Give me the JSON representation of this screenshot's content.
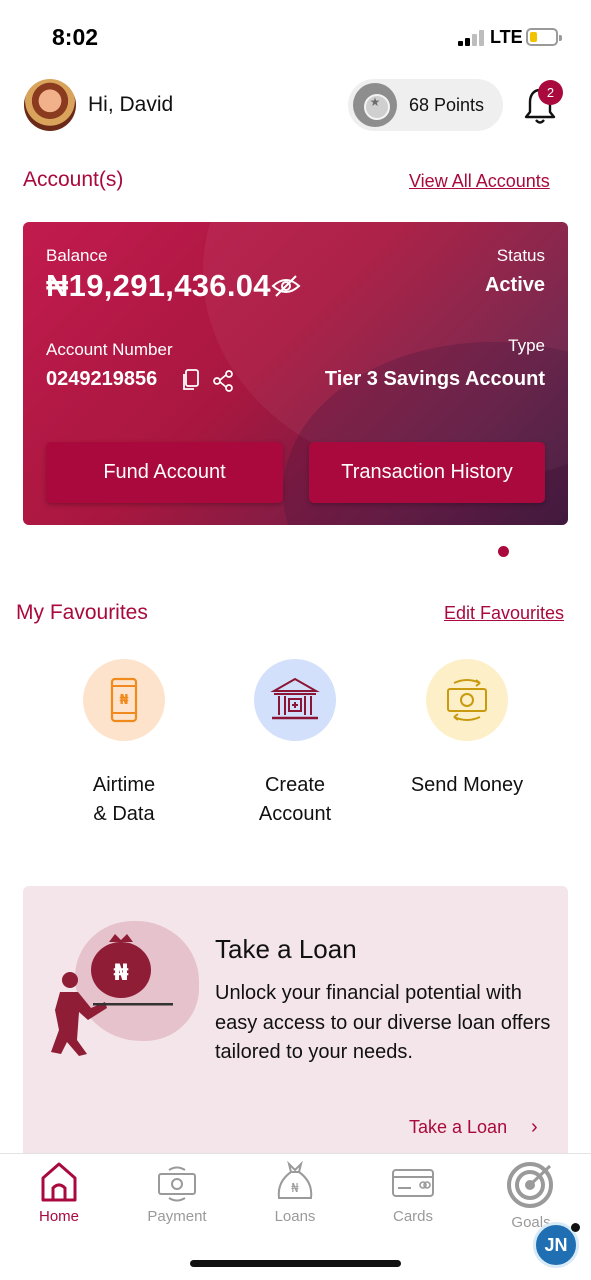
{
  "status_bar": {
    "time": "8:02",
    "network": "LTE"
  },
  "header": {
    "greeting": "Hi, David",
    "points": "68 Points",
    "notification_count": "2"
  },
  "accounts": {
    "title": "Account(s)",
    "view_all": "View All Accounts",
    "card": {
      "balance_label": "Balance",
      "balance": "₦19,291,436.04",
      "status_label": "Status",
      "status": "Active",
      "account_number_label": "Account Number",
      "account_number": "0249219856",
      "type_label": "Type",
      "type": "Tier 3 Savings Account",
      "fund_button": "Fund Account",
      "history_button": "Transaction History"
    }
  },
  "favourites": {
    "title": "My Favourites",
    "edit": "Edit Favourites",
    "items": [
      {
        "line1": "Airtime",
        "line2": "& Data",
        "icon": "phone-naira-icon",
        "bg": "#fde3cc"
      },
      {
        "line1": "Create",
        "line2": "Account",
        "icon": "bank-building-icon",
        "bg": "#d3e0fb"
      },
      {
        "line1": "Send Money",
        "line2": "",
        "icon": "cash-transfer-icon",
        "bg": "#fdf0c8"
      }
    ]
  },
  "loan": {
    "title": "Take a Loan",
    "text": "Unlock your financial potential with easy access to our diverse loan offers tailored to your needs.",
    "link": "Take a Loan"
  },
  "tabs": [
    {
      "label": "Home",
      "icon": "home-icon",
      "active": true
    },
    {
      "label": "Payment",
      "icon": "payment-icon",
      "active": false
    },
    {
      "label": "Loans",
      "icon": "loans-icon",
      "active": false
    },
    {
      "label": "Cards",
      "icon": "cards-icon",
      "active": false
    },
    {
      "label": "Goals",
      "icon": "goals-icon",
      "active": false
    }
  ],
  "watermark": "JN",
  "colors": {
    "brand": "#a9093d",
    "card_start": "#c21b4e",
    "card_end": "#431b3e",
    "loan_bg": "#f3e5e9"
  }
}
